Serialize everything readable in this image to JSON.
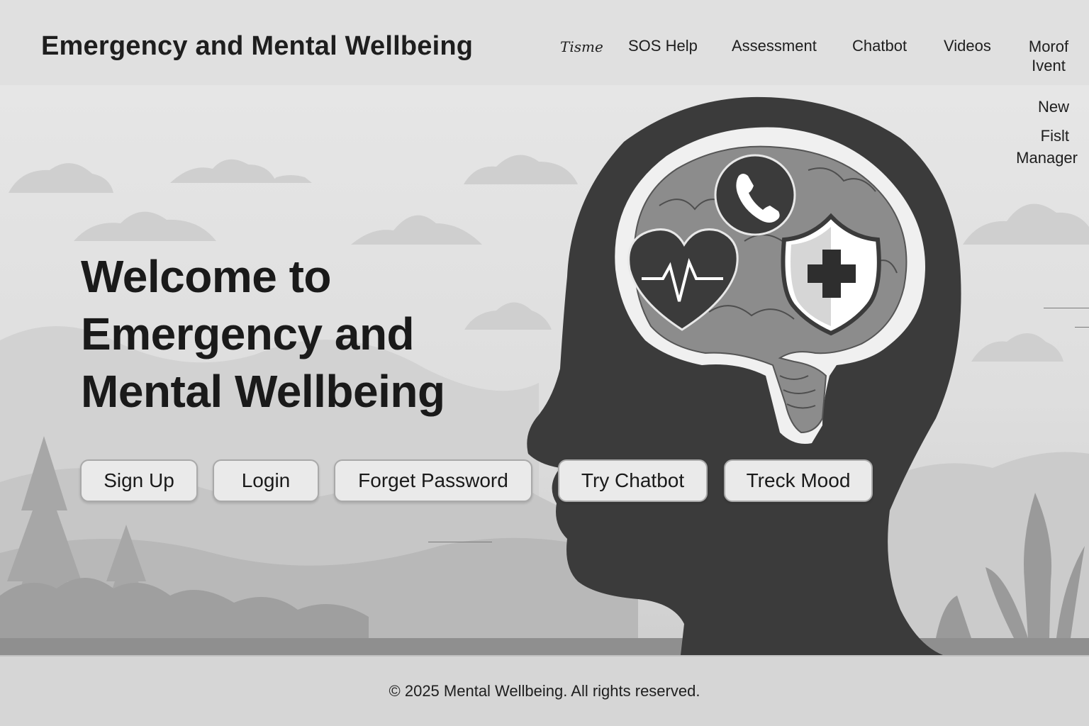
{
  "header": {
    "brand": "Emergency and Mental Wellbeing",
    "nav": {
      "home": "Tisme",
      "sos": "SOS Help",
      "assessment": "Assessment",
      "chatbot": "Chatbot",
      "videos": "Videos",
      "more_line1": "Morof",
      "more_line2": "Ivent"
    }
  },
  "side_menu": {
    "new": "New",
    "first": "Fislt",
    "manager": "Manager"
  },
  "hero": {
    "title_line1": "Welcome to",
    "title_line2": "Emergency and",
    "title_line3": "Mental Wellbeing",
    "buttons": {
      "signup": "Sign Up",
      "login": "Login",
      "forget": "Forget Password",
      "chatbot": "Try Chatbot",
      "mood": "Treck Mood"
    },
    "illustration_icons": [
      "head-silhouette-icon",
      "brain-icon",
      "phone-icon",
      "heart-pulse-icon",
      "shield-cross-icon"
    ]
  },
  "footer": {
    "copyright": "© 2025 Mental Wellbeing. All rights reserved."
  },
  "colors": {
    "page_bg": "#dcdcdc",
    "header_bg": "#e0e0e0",
    "silhouette": "#3b3b3b",
    "brain": "#8c8c8c",
    "button_bg": "#eaeaea",
    "text": "#1c1c1c"
  }
}
